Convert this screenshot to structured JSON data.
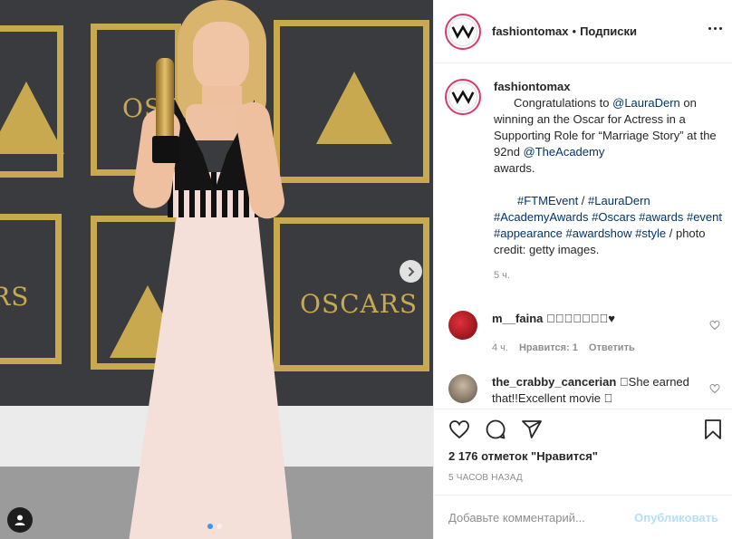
{
  "media": {
    "backdrop_text": [
      "OSCARS",
      "OSCARS",
      "ARS"
    ],
    "accent_gold": "#c8a950",
    "carousel_dots": 2,
    "carousel_active": 1
  },
  "header": {
    "username": "fashiontomax",
    "separator": "•",
    "follow_label": "Подписки"
  },
  "caption": {
    "username": "fashiontomax",
    "text_1": "Congratulations to ",
    "mention_1": "@LauraDern",
    "text_2": " on winning an the Oscar for Actress in a Supporting Role for “Marriage Story” at the 92nd ",
    "mention_2": "@TheAcademy",
    "text_3": " awards.",
    "tag_1": "#FTMEvent",
    "slash_1": " / ",
    "tag_2": "#LauraDern",
    "tag_3": "#AcademyAwards",
    "tag_4": "#Oscars",
    "tag_5": "#awards",
    "tag_6": "#event",
    "tag_7": "#appearance",
    "tag_8": "#awardshow",
    "tag_9": "#style",
    "credit": " / photo credit: getty images.",
    "age": "5 ч."
  },
  "comments": [
    {
      "username": "m__faina",
      "text": "󾌷󾌷󾌷󾌷󾌷󾌷󾌷♥",
      "age": "4 ч.",
      "likes": "Нравится: 1",
      "reply": "Ответить"
    },
    {
      "username": "the_crabby_cancerian",
      "text": "󾌷She earned that!!Excellent movie 󾌷"
    }
  ],
  "actions": {
    "likes_count": "2 176 отметок \"Нравится\"",
    "posted_ago": "5 ЧАСОВ НАЗАД",
    "comment_placeholder": "Добавьте комментарий...",
    "publish_label": "Опубликовать"
  },
  "colors": {
    "link": "#003569",
    "publish_disabled": "#b2dffc",
    "active_dot": "#3897f0"
  }
}
